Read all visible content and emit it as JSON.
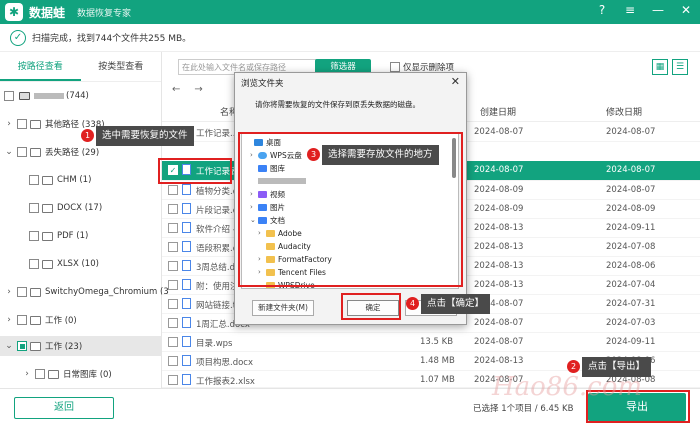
{
  "app": {
    "logo": "✱",
    "name": "数据蛙",
    "subtitle": "数据恢复专家"
  },
  "window_controls": [
    "?",
    "≡",
    "—",
    "✕"
  ],
  "scan": {
    "status": "扫描完成，找到744个文件共255 MB。"
  },
  "sidebar": {
    "tabs": [
      "按路径查看",
      "按类型查看"
    ],
    "disk_count": "(744)",
    "items": [
      {
        "label": "其他路径 (338)"
      },
      {
        "label": "丢失路径 (29)"
      },
      {
        "label": "CHM (1)"
      },
      {
        "label": "DOCX (17)"
      },
      {
        "label": "PDF (1)"
      },
      {
        "label": "XLSX (10)"
      },
      {
        "label": "SwitchyOmega_Chromium (3"
      },
      {
        "label": "工作 (0)"
      },
      {
        "label": "工作 (23)"
      },
      {
        "label": "日常图库 (0)"
      }
    ]
  },
  "toolbar": {
    "search_placeholder": "在此处输入文件名或保存路径",
    "filter_label": "筛选器",
    "only_deleted_label": "仅显示删除项"
  },
  "columns": {
    "name": "名称",
    "size": "大小",
    "created": "创建日期",
    "modified": "修改日期"
  },
  "rows": [
    {
      "name": "工作记录...",
      "size": "",
      "created": "2024-08-07",
      "modified": "2024-08-07"
    },
    {
      "name": "工作记录表",
      "size": "",
      "created": "2024-08-07",
      "modified": "2024-08-07"
    },
    {
      "name": "植物分类.d...",
      "size": "",
      "created": "2024-08-09",
      "modified": "2024-08-07"
    },
    {
      "name": "片段记录.d...",
      "size": "",
      "created": "2024-08-09",
      "modified": "2024-08-09"
    },
    {
      "name": "软件介绍 -...",
      "size": "",
      "created": "2024-08-13",
      "modified": "2024-09-11"
    },
    {
      "name": "语段积累.d...",
      "size": "",
      "created": "2024-08-13",
      "modified": "2024-07-08"
    },
    {
      "name": "3周总结.doc...",
      "size": "",
      "created": "2024-08-13",
      "modified": "2024-08-06"
    },
    {
      "name": "附：使用注...",
      "size": "",
      "created": "2024-08-13",
      "modified": "2024-07-04"
    },
    {
      "name": "网站链接.t...",
      "size": "",
      "created": "2024-08-07",
      "modified": "2024-07-31"
    },
    {
      "name": "1周汇总.docx",
      "size": "",
      "created": "2024-08-07",
      "modified": "2024-07-03"
    },
    {
      "name": "目录.wps",
      "size": "13.5 KB",
      "created": "2024-08-07",
      "modified": "2024-09-11"
    },
    {
      "name": "项目构思.docx",
      "size": "1.48 MB",
      "created": "2024-08-13",
      "modified": "2024-08-06"
    },
    {
      "name": "工作报表2.xlsx",
      "size": "1.07 MB",
      "created": "2024-08-07",
      "modified": "2024-08-08"
    }
  ],
  "dialog": {
    "title": "浏览文件夹",
    "message": "请你将需要恢复的文件保存到原丢失数据的磁盘。",
    "tree": [
      {
        "label": "桌面"
      },
      {
        "label": "WPS云盘"
      },
      {
        "label": "图库"
      },
      {
        "label": "视频"
      },
      {
        "label": "图片"
      },
      {
        "label": "文档"
      },
      {
        "label": "Adobe"
      },
      {
        "label": "Audacity"
      },
      {
        "label": "FormatFactory"
      },
      {
        "label": "Tencent Files"
      },
      {
        "label": "WPSDrive"
      }
    ],
    "new_folder": "新建文件夹(M)",
    "ok": "确定"
  },
  "annotations": [
    {
      "num": "1",
      "text": "选中需要恢复的文件"
    },
    {
      "num": "3",
      "text": "选择需要存放文件的地方"
    },
    {
      "num": "4",
      "text": "点击【确定】"
    },
    {
      "num": "2",
      "text": "点击【导出】"
    }
  ],
  "footer": {
    "back": "返回",
    "selection_info": "已选择 1个项目 / 6.45 KB",
    "export": "导出"
  },
  "watermark": "Hao86.com",
  "colors": {
    "brand": "#12a37f",
    "annotation": "#e02020",
    "callout_bg": "#4a4a4a"
  }
}
